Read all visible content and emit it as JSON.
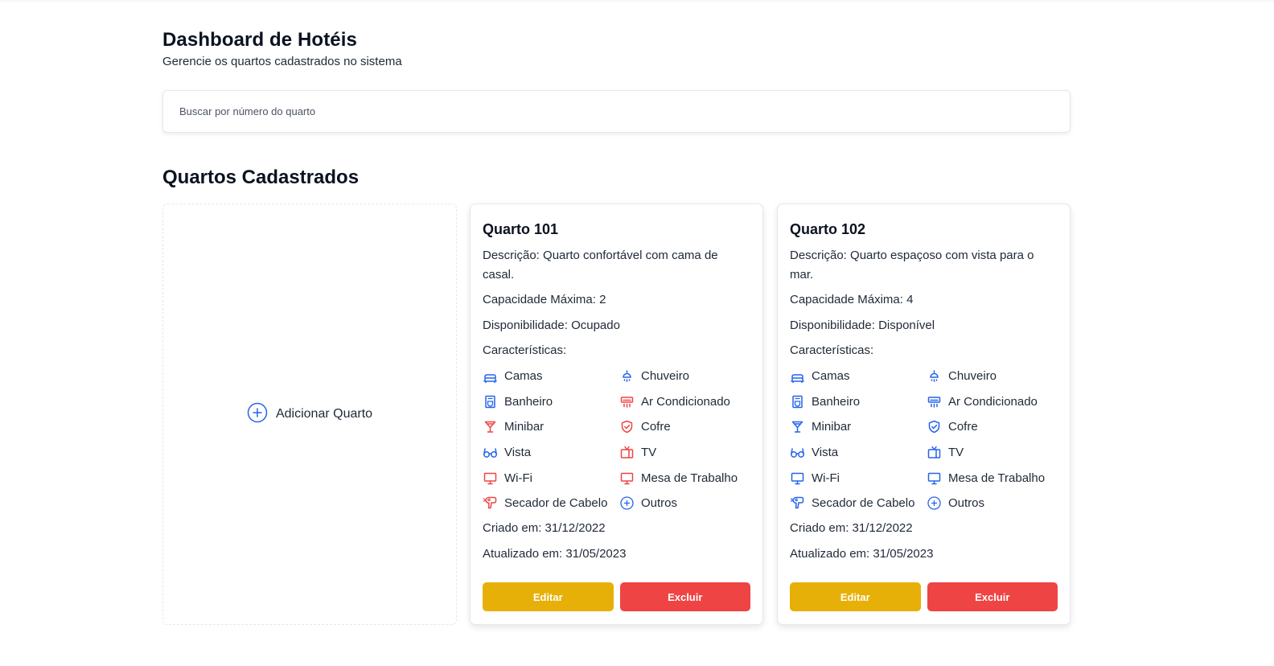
{
  "header": {
    "title": "Dashboard de Hotéis",
    "subtitle": "Gerencie os quartos cadastrados no sistema"
  },
  "search": {
    "placeholder": "Buscar por número do quarto",
    "value": ""
  },
  "section_title": "Quartos Cadastrados",
  "add_card": {
    "label": "Adicionar Quarto",
    "icon": "plus-circle-icon"
  },
  "colors": {
    "accent_blue": "#2563eb",
    "accent_red": "#ef4444",
    "edit_button": "#e7b008",
    "delete_button": "#ef4444"
  },
  "rooms": [
    {
      "title": "Quarto 101",
      "description": "Descrição: Quarto confortável com cama de casal.",
      "capacity": "Capacidade Máxima: 2",
      "availability": "Disponibilidade: Ocupado",
      "features_label": "Características:",
      "features": [
        {
          "label": "Camas",
          "icon": "bed-icon",
          "color": "#2563eb"
        },
        {
          "label": "Chuveiro",
          "icon": "shower-icon",
          "color": "#2563eb"
        },
        {
          "label": "Banheiro",
          "icon": "bathroom-icon",
          "color": "#2563eb"
        },
        {
          "label": "Ar Condicionado",
          "icon": "air-conditioner-icon",
          "color": "#ef4444"
        },
        {
          "label": "Minibar",
          "icon": "cocktail-icon",
          "color": "#ef4444"
        },
        {
          "label": "Cofre",
          "icon": "shield-check-icon",
          "color": "#ef4444"
        },
        {
          "label": "Vista",
          "icon": "glasses-icon",
          "color": "#2563eb"
        },
        {
          "label": "TV",
          "icon": "tv-icon",
          "color": "#ef4444"
        },
        {
          "label": "Wi-Fi",
          "icon": "monitor-icon",
          "color": "#ef4444"
        },
        {
          "label": "Mesa de Trabalho",
          "icon": "monitor-icon",
          "color": "#ef4444"
        },
        {
          "label": "Secador de Cabelo",
          "icon": "hair-dryer-icon",
          "color": "#ef4444"
        },
        {
          "label": "Outros",
          "icon": "plus-circle-icon",
          "color": "#2563eb"
        }
      ],
      "created": "Criado em: 31/12/2022",
      "updated": "Atualizado em: 31/05/2023",
      "edit_label": "Editar",
      "delete_label": "Excluir"
    },
    {
      "title": "Quarto 102",
      "description": "Descrição: Quarto espaçoso com vista para o mar.",
      "capacity": "Capacidade Máxima: 4",
      "availability": "Disponibilidade: Disponível",
      "features_label": "Características:",
      "features": [
        {
          "label": "Camas",
          "icon": "bed-icon",
          "color": "#2563eb"
        },
        {
          "label": "Chuveiro",
          "icon": "shower-icon",
          "color": "#2563eb"
        },
        {
          "label": "Banheiro",
          "icon": "bathroom-icon",
          "color": "#2563eb"
        },
        {
          "label": "Ar Condicionado",
          "icon": "air-conditioner-icon",
          "color": "#2563eb"
        },
        {
          "label": "Minibar",
          "icon": "cocktail-icon",
          "color": "#2563eb"
        },
        {
          "label": "Cofre",
          "icon": "shield-check-icon",
          "color": "#2563eb"
        },
        {
          "label": "Vista",
          "icon": "glasses-icon",
          "color": "#2563eb"
        },
        {
          "label": "TV",
          "icon": "tv-icon",
          "color": "#2563eb"
        },
        {
          "label": "Wi-Fi",
          "icon": "monitor-icon",
          "color": "#2563eb"
        },
        {
          "label": "Mesa de Trabalho",
          "icon": "monitor-icon",
          "color": "#2563eb"
        },
        {
          "label": "Secador de Cabelo",
          "icon": "hair-dryer-icon",
          "color": "#2563eb"
        },
        {
          "label": "Outros",
          "icon": "plus-circle-icon",
          "color": "#2563eb"
        }
      ],
      "created": "Criado em: 31/12/2022",
      "updated": "Atualizado em: 31/05/2023",
      "edit_label": "Editar",
      "delete_label": "Excluir"
    }
  ]
}
